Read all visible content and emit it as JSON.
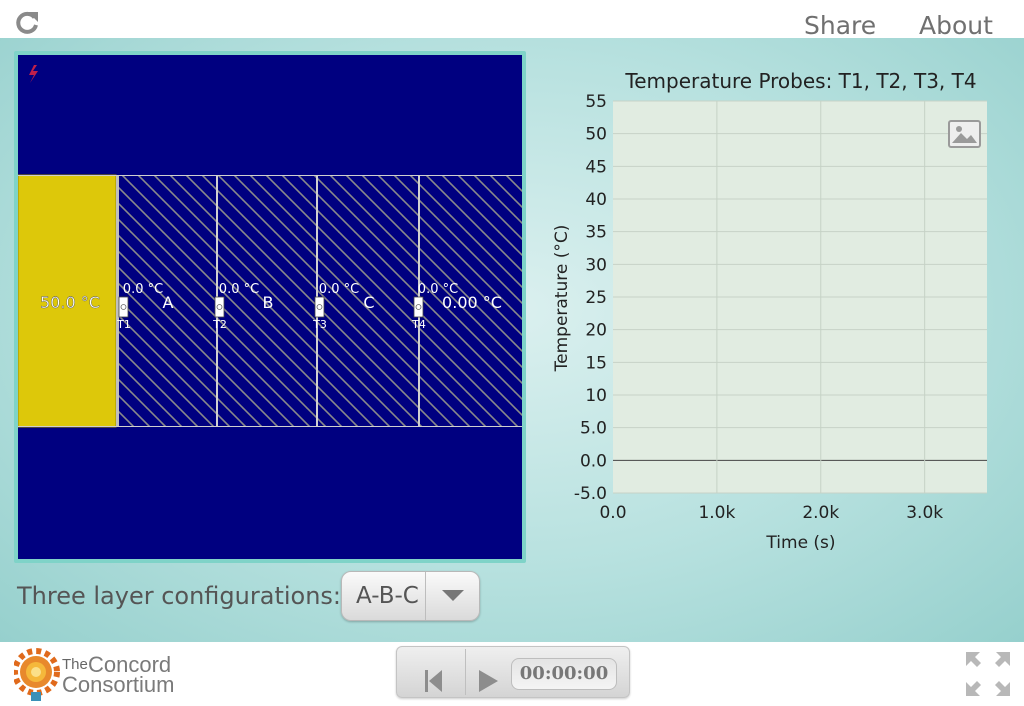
{
  "topbar": {
    "share_label": "Share",
    "about_label": "About"
  },
  "simulation": {
    "heat_source_temp": "50.0 °C",
    "right_temp": "0.00 °C",
    "layers": [
      "A",
      "B",
      "C"
    ],
    "probes": [
      {
        "label": "T1",
        "reading": "0.0 °C"
      },
      {
        "label": "T2",
        "reading": "0.0 °C"
      },
      {
        "label": "T3",
        "reading": "0.0 °C"
      },
      {
        "label": "T4",
        "reading": "0.0 °C"
      }
    ],
    "colors": {
      "background": "#000080",
      "heater": "#ddc80a",
      "hatch": "#8a8a8a",
      "frame": "#7fd3c8"
    }
  },
  "chart_data": {
    "type": "line",
    "title": "Temperature Probes: T1, T2, T3, T4",
    "xlabel": "Time (s)",
    "ylabel": "Temperature (°C)",
    "xlim": [
      0,
      3600
    ],
    "ylim": [
      -5,
      55
    ],
    "x_ticks": [
      0,
      1000,
      2000,
      3000
    ],
    "x_tick_labels": [
      "0.0",
      "1.0k",
      "2.0k",
      "3.0k"
    ],
    "y_ticks": [
      -5,
      0,
      5,
      10,
      15,
      20,
      25,
      30,
      35,
      40,
      45,
      50,
      55
    ],
    "y_tick_labels": [
      "-5.0",
      "0.0",
      "5.0",
      "10",
      "15",
      "20",
      "25",
      "30",
      "35",
      "40",
      "45",
      "50",
      "55"
    ],
    "grid": true,
    "series": [],
    "colors": {
      "plot_bg": "#e1ece1",
      "grid": "#c6d2c6",
      "zero_line": "#444444"
    }
  },
  "controls": {
    "config_label": "Three layer configurations:",
    "config_value": "A-B-C"
  },
  "footer": {
    "logo_the": "The",
    "logo_concord": "Concord",
    "logo_consortium": "Consortium",
    "time": "00:00:00"
  }
}
